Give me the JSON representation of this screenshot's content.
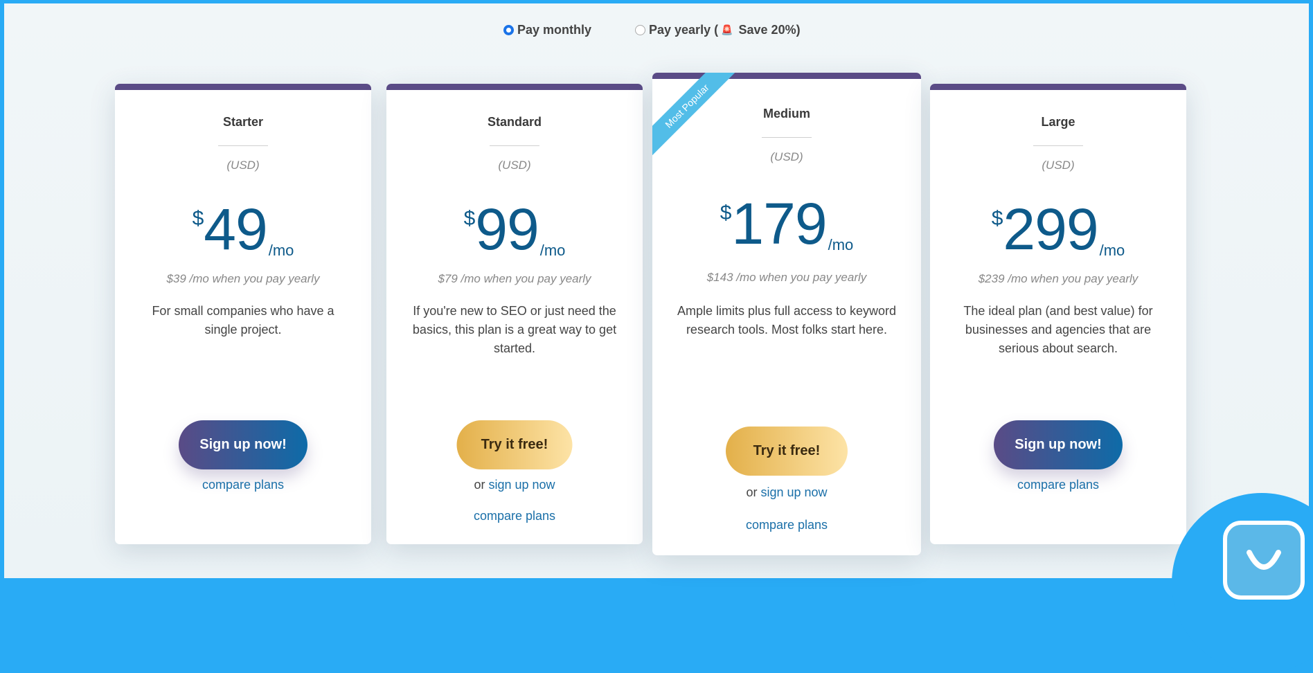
{
  "billing_toggle": {
    "monthly_label": "Pay monthly",
    "yearly_prefix": "Pay yearly (",
    "yearly_emoji": "🚨",
    "yearly_suffix": "Save 20%)",
    "selected": "monthly"
  },
  "plans": [
    {
      "name": "Starter",
      "currency": "(USD)",
      "symbol": "$",
      "price": "49",
      "per": "/mo",
      "yearly_note": "$39 /mo when you pay yearly",
      "description": "For small companies who have a single project.",
      "button": "Sign up now!",
      "compare": "compare plans"
    },
    {
      "name": "Standard",
      "currency": "(USD)",
      "symbol": "$",
      "price": "99",
      "per": "/mo",
      "yearly_note": "$79 /mo when you pay yearly",
      "description": "If you're new to SEO or just need the basics, this plan is a great way to get started.",
      "button": "Try it free!",
      "or_prefix": "or",
      "signup_link": "sign up now",
      "compare": "compare plans"
    },
    {
      "name": "Medium",
      "ribbon": "Most Popular",
      "currency": "(USD)",
      "symbol": "$",
      "price": "179",
      "per": "/mo",
      "yearly_note": "$143 /mo when you pay yearly",
      "description": "Ample limits plus full access to keyword research tools. Most folks start here.",
      "button": "Try it free!",
      "or_prefix": "or",
      "signup_link": "sign up now",
      "compare": "compare plans"
    },
    {
      "name": "Large",
      "currency": "(USD)",
      "symbol": "$",
      "price": "299",
      "per": "/mo",
      "yearly_note": "$239 /mo when you pay yearly",
      "description": "The ideal plan (and best value) for businesses and agencies that are serious about search.",
      "button": "Sign up now!",
      "compare": "compare plans"
    }
  ],
  "chat_widget": {
    "icon": "chat-bubble-smile-icon"
  },
  "colors": {
    "page_accent": "#29abf5",
    "card_bar": "#5a4b86",
    "price_text": "#0e5a8a",
    "link": "#1a6fa8",
    "ribbon": "#52bde8"
  }
}
